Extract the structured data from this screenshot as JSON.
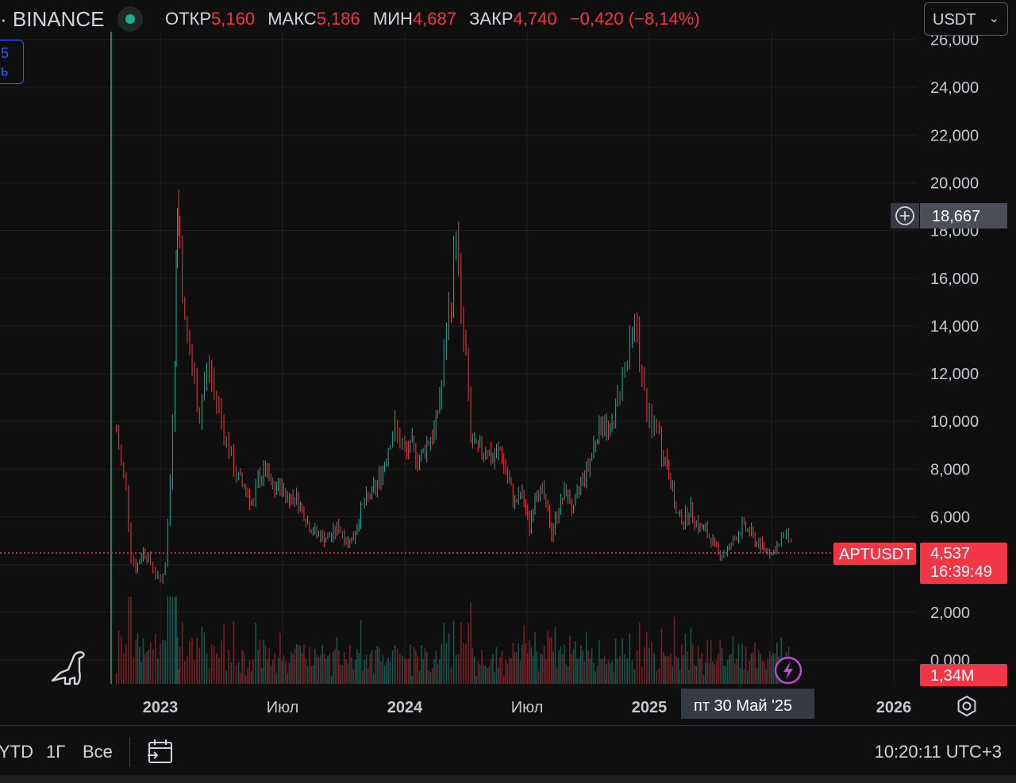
{
  "header": {
    "exchange": "· BINANCE",
    "ohlc": [
      {
        "label": "ОТКР",
        "value": "5,160"
      },
      {
        "label": "МАКС",
        "value": "5,186"
      },
      {
        "label": "МИН",
        "value": "4,687"
      },
      {
        "label": "ЗАКР",
        "value": "4,740"
      }
    ],
    "change": "−0,420 (−8,14%)",
    "currency": "USDT",
    "currency_chevron": "chevron-down-icon"
  },
  "legend_box": {
    "line1": "5",
    "line2": "ь"
  },
  "colors": {
    "up": "#22ab94",
    "down": "#f23645",
    "accent": "#2962ff",
    "bg": "#0f0f0f"
  },
  "chart_data": {
    "type": "candlestick",
    "y_ticks": [
      "26,000",
      "24,000",
      "22,000",
      "20,000",
      "18,000",
      "16,000",
      "14,000",
      "12,000",
      "10,000",
      "8,000",
      "6,000",
      "2,000",
      "0,000"
    ],
    "x_ticks": [
      {
        "label": "2023",
        "bold": true
      },
      {
        "label": "Июл",
        "bold": false
      },
      {
        "label": "2024",
        "bold": true
      },
      {
        "label": "Июл",
        "bold": false
      },
      {
        "label": "2025",
        "bold": true
      },
      {
        "label": "2026",
        "bold": true
      }
    ],
    "ylim": [
      0,
      26000
    ],
    "series_close": [
      [
        2022.82,
        9600
      ],
      [
        2022.84,
        8200
      ],
      [
        2022.86,
        7200
      ],
      [
        2022.88,
        4400
      ],
      [
        2022.9,
        3800
      ],
      [
        2022.93,
        4600
      ],
      [
        2022.96,
        4100
      ],
      [
        2022.98,
        3600
      ],
      [
        2023.0,
        3300
      ],
      [
        2023.02,
        4000
      ],
      [
        2023.04,
        7500
      ],
      [
        2023.06,
        13000
      ],
      [
        2023.07,
        19500
      ],
      [
        2023.08,
        17500
      ],
      [
        2023.1,
        14000
      ],
      [
        2023.12,
        12800
      ],
      [
        2023.14,
        11500
      ],
      [
        2023.16,
        10200
      ],
      [
        2023.18,
        11800
      ],
      [
        2023.2,
        12200
      ],
      [
        2023.22,
        11200
      ],
      [
        2023.24,
        10600
      ],
      [
        2023.26,
        9600
      ],
      [
        2023.28,
        8800
      ],
      [
        2023.3,
        8000
      ],
      [
        2023.32,
        7600
      ],
      [
        2023.35,
        7200
      ],
      [
        2023.38,
        6400
      ],
      [
        2023.4,
        7600
      ],
      [
        2023.43,
        7900
      ],
      [
        2023.46,
        7100
      ],
      [
        2023.49,
        7300
      ],
      [
        2023.52,
        6800
      ],
      [
        2023.55,
        6900
      ],
      [
        2023.58,
        6300
      ],
      [
        2023.61,
        5600
      ],
      [
        2023.64,
        5300
      ],
      [
        2023.67,
        5100
      ],
      [
        2023.7,
        5200
      ],
      [
        2023.73,
        5600
      ],
      [
        2023.76,
        5000
      ],
      [
        2023.79,
        5100
      ],
      [
        2023.82,
        6300
      ],
      [
        2023.85,
        6800
      ],
      [
        2023.88,
        7200
      ],
      [
        2023.91,
        8000
      ],
      [
        2023.94,
        9300
      ],
      [
        2023.96,
        9700
      ],
      [
        2023.98,
        9100
      ],
      [
        2024.0,
        8700
      ],
      [
        2024.03,
        8900
      ],
      [
        2024.06,
        8400
      ],
      [
        2024.09,
        9100
      ],
      [
        2024.12,
        9500
      ],
      [
        2024.15,
        11500
      ],
      [
        2024.17,
        13800
      ],
      [
        2024.19,
        15200
      ],
      [
        2024.21,
        18300
      ],
      [
        2024.23,
        14200
      ],
      [
        2024.25,
        12600
      ],
      [
        2024.27,
        9200
      ],
      [
        2024.3,
        8700
      ],
      [
        2024.33,
        8900
      ],
      [
        2024.36,
        8400
      ],
      [
        2024.39,
        8800
      ],
      [
        2024.42,
        7600
      ],
      [
        2024.45,
        6600
      ],
      [
        2024.48,
        6900
      ],
      [
        2024.51,
        5600
      ],
      [
        2024.54,
        7300
      ],
      [
        2024.57,
        6800
      ],
      [
        2024.6,
        5300
      ],
      [
        2024.63,
        6400
      ],
      [
        2024.66,
        7100
      ],
      [
        2024.69,
        6200
      ],
      [
        2024.72,
        7500
      ],
      [
        2024.75,
        8100
      ],
      [
        2024.78,
        9300
      ],
      [
        2024.81,
        10100
      ],
      [
        2024.84,
        9400
      ],
      [
        2024.87,
        10900
      ],
      [
        2024.89,
        12100
      ],
      [
        2024.91,
        12500
      ],
      [
        2024.93,
        13600
      ],
      [
        2024.95,
        13900
      ],
      [
        2024.97,
        11600
      ],
      [
        2024.99,
        10400
      ],
      [
        2025.01,
        9600
      ],
      [
        2025.03,
        9900
      ],
      [
        2025.05,
        8800
      ],
      [
        2025.08,
        8000
      ],
      [
        2025.11,
        6100
      ],
      [
        2025.14,
        5900
      ],
      [
        2025.17,
        6300
      ],
      [
        2025.2,
        5600
      ],
      [
        2025.23,
        5400
      ],
      [
        2025.26,
        4900
      ],
      [
        2025.29,
        4400
      ],
      [
        2025.32,
        4600
      ],
      [
        2025.35,
        5100
      ],
      [
        2025.38,
        5600
      ],
      [
        2025.41,
        5400
      ],
      [
        2025.44,
        4900
      ],
      [
        2025.47,
        4700
      ],
      [
        2025.5,
        4500
      ],
      [
        2025.53,
        4800
      ],
      [
        2025.55,
        5300
      ],
      [
        2025.57,
        5200
      ],
      [
        2025.59,
        4740
      ]
    ],
    "volume_label": "1,34M"
  },
  "price_line": {
    "symbol": "APTUSDT",
    "price": "4,537",
    "countdown": "16:39:49"
  },
  "crosshair": {
    "price": "18,667",
    "date": "пт 30 Май '25",
    "add_icon": "plus-circle-icon"
  },
  "overlays": {
    "logo_icon": "dinosaur-icon",
    "flash_icon": "lightning-icon",
    "settings_icon": "gear-icon"
  },
  "bottom_bar": {
    "ranges": [
      "YTD",
      "1Г",
      "Все"
    ],
    "calendar_icon": "calendar-goto-icon",
    "clock": "10:20:11 UTC+3"
  }
}
